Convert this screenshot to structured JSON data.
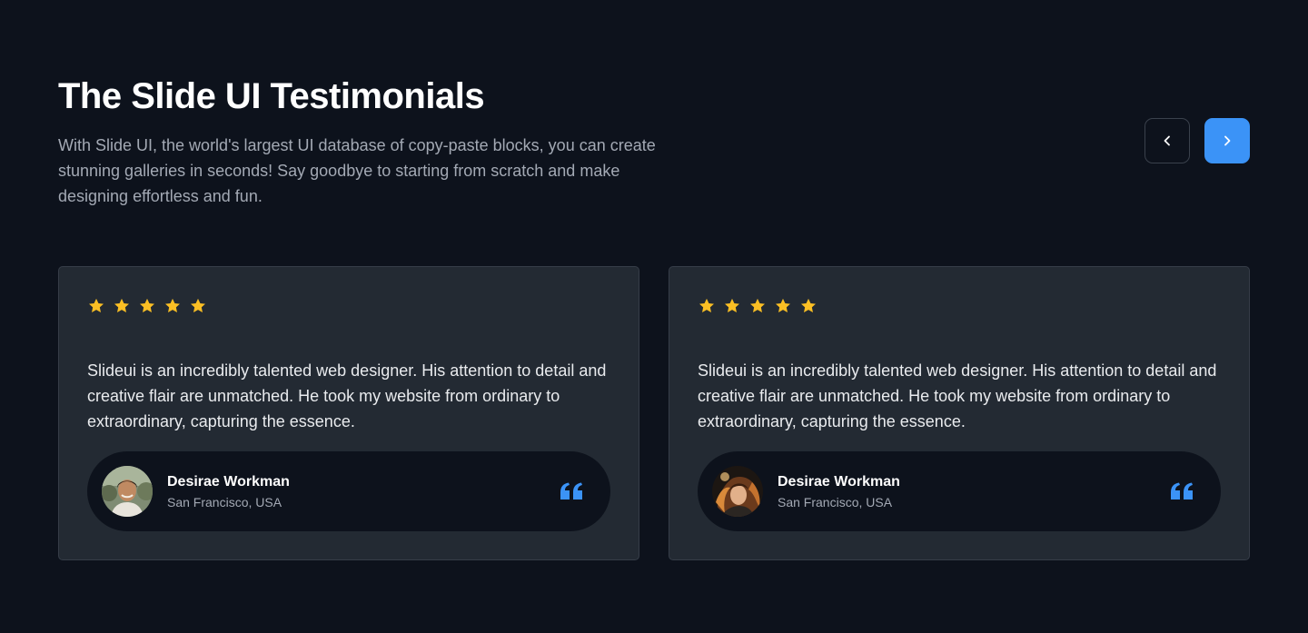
{
  "header": {
    "title": "The Slide UI Testimonials",
    "subtitle": "With Slide UI, the world's largest UI database of copy-paste blocks, you can create stunning galleries in seconds! Say goodbye to starting from scratch and make designing effortless and fun."
  },
  "nav": {
    "prev_icon": "chevron-left-icon",
    "next_icon": "chevron-right-icon"
  },
  "colors": {
    "background": "#0d121c",
    "card": "#232a33",
    "accent": "#3b93f7",
    "star": "#fbbf24"
  },
  "testimonials": [
    {
      "rating": 5,
      "quote": "Slideui is an incredibly talented web designer. His attention to detail and creative flair are unmatched. He took my website from ordinary to extraordinary, capturing the essence.",
      "name": "Desirae Workman",
      "location": "San Francisco, USA",
      "avatar": "avatar-photo-man"
    },
    {
      "rating": 5,
      "quote": "Slideui is an incredibly talented web designer. His attention to detail and creative flair are unmatched. He took my website from ordinary to extraordinary, capturing the essence.",
      "name": "Desirae Workman",
      "location": "San Francisco, USA",
      "avatar": "avatar-photo-woman"
    }
  ]
}
